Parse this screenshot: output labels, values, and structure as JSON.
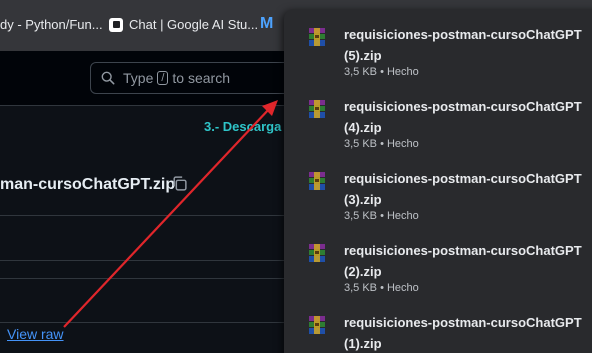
{
  "bookmarks": {
    "items": [
      {
        "label": "dy - Python/Fun..."
      },
      {
        "label": "Chat | Google AI Stu..."
      },
      {
        "label": "M"
      }
    ]
  },
  "search": {
    "prefix": "Type",
    "key": "/",
    "suffix": "to search"
  },
  "annotation": "3.- Descarga",
  "file": {
    "name": "man-cursoChatGPT.zip",
    "view_raw": "View raw"
  },
  "downloads": [
    {
      "name_line1": "requisiciones-postman-cursoChatGPT",
      "name_line2": "(5).zip",
      "status": "3,5 KB • Hecho"
    },
    {
      "name_line1": "requisiciones-postman-cursoChatGPT",
      "name_line2": "(4).zip",
      "status": "3,5 KB • Hecho"
    },
    {
      "name_line1": "requisiciones-postman-cursoChatGPT",
      "name_line2": "(3).zip",
      "status": "3,5 KB • Hecho"
    },
    {
      "name_line1": "requisiciones-postman-cursoChatGPT",
      "name_line2": "(2).zip",
      "status": "3,5 KB • Hecho"
    },
    {
      "name_line1": "requisiciones-postman-cursoChatGPT",
      "name_line2": "(1).zip",
      "status": ""
    }
  ],
  "colors": {
    "annotation": "#2fc5c9",
    "arrow": "#e0262b",
    "link": "#4493f8"
  }
}
